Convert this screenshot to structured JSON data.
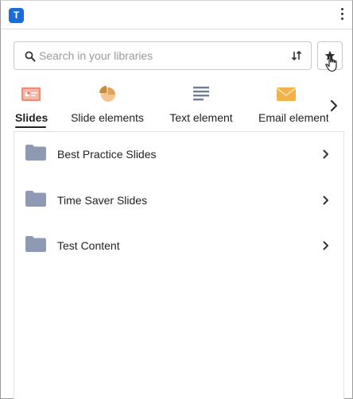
{
  "app": {
    "logo_letter": "T"
  },
  "search": {
    "placeholder": "Search in your libraries",
    "value": ""
  },
  "tabs": [
    {
      "label": "Slides",
      "icon": "slides-icon",
      "active": true
    },
    {
      "label": "Slide elements",
      "icon": "pie-chart-icon",
      "active": false
    },
    {
      "label": "Text element",
      "icon": "text-lines-icon",
      "active": false
    },
    {
      "label": "Email element",
      "icon": "envelope-icon",
      "active": false
    }
  ],
  "folders": [
    {
      "name": "Best Practice Slides"
    },
    {
      "name": "Time Saver Slides"
    },
    {
      "name": "Test Content"
    }
  ],
  "colors": {
    "logo": "#1a6dd8",
    "folder": "#8e99b3",
    "slides_icon": "#f08a74",
    "pie_icon": "#e0a35a",
    "text_icon": "#6f7f99",
    "envelope_icon": "#f2b24a"
  }
}
